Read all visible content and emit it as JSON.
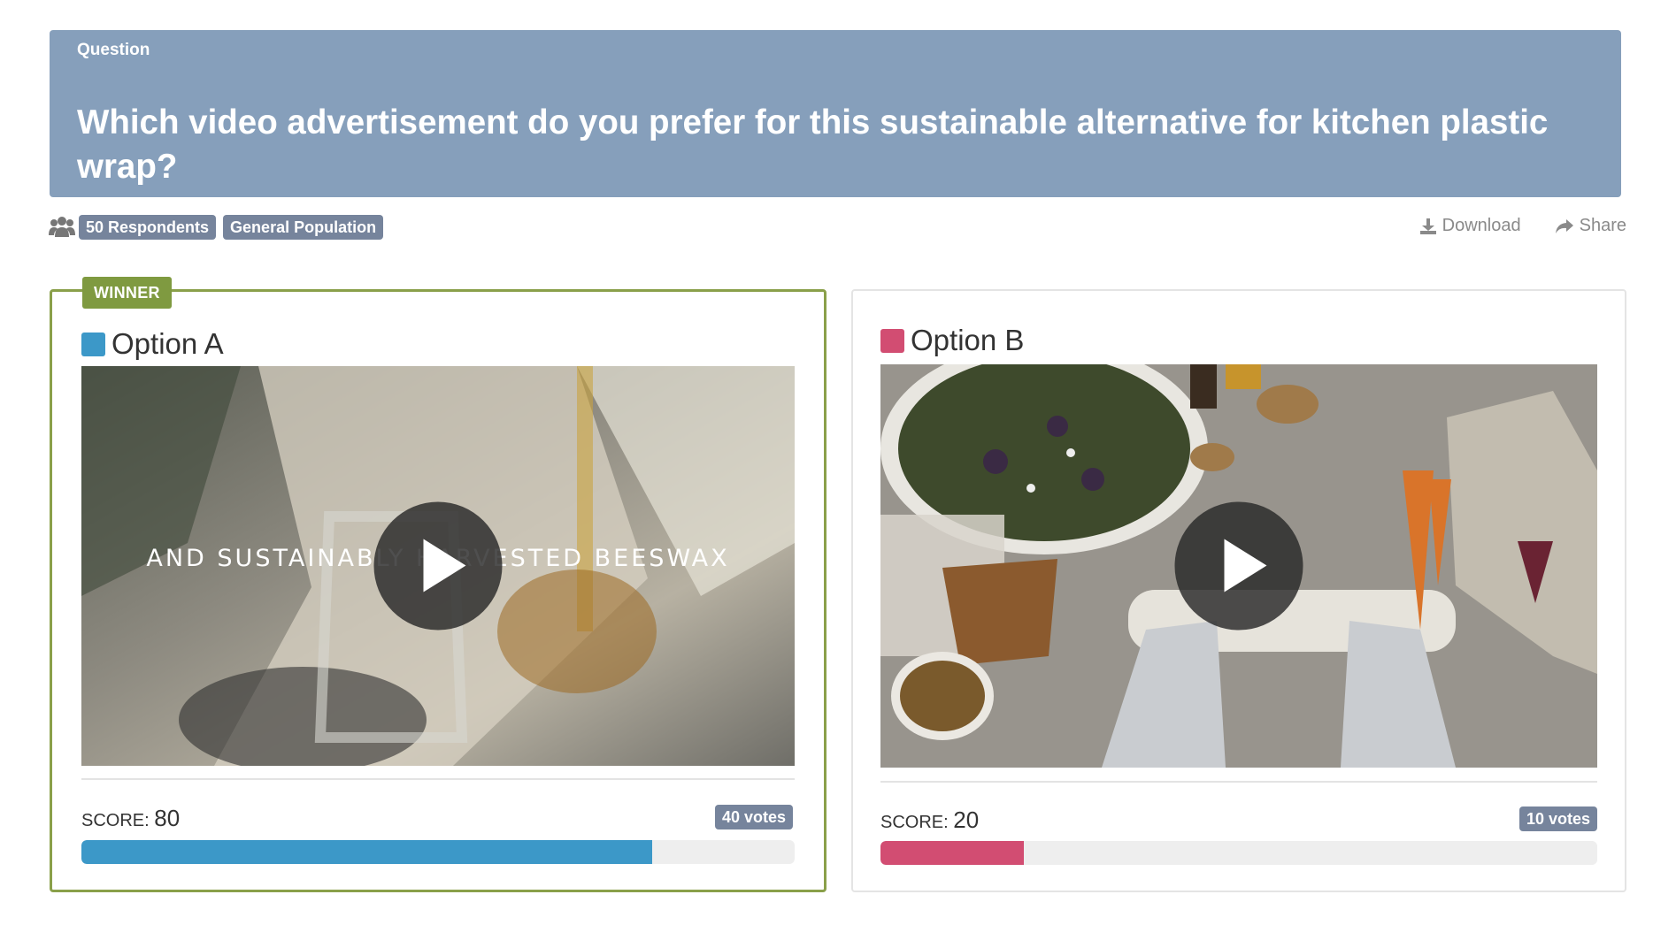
{
  "question": {
    "label": "Question",
    "text": "Which video advertisement do you prefer for this sustainable alternative for kitchen plastic wrap?"
  },
  "meta": {
    "icon": "people-icon",
    "respondents": "50 Respondents",
    "audience": "General Population"
  },
  "actions": {
    "download": "Download",
    "share": "Share"
  },
  "options": [
    {
      "winner_label": "WINNER",
      "title": "Option A",
      "color": "#3c98c8",
      "video_caption": "AND SUSTAINABLY HARVESTED BEESWAX",
      "score_label": "SCORE:",
      "score": "80",
      "score_fraction": 0.8,
      "votes": "40 votes"
    },
    {
      "title": "Option B",
      "color": "#d24d72",
      "score_label": "SCORE:",
      "score": "20",
      "score_fraction": 0.2,
      "votes": "10 votes"
    }
  ],
  "colors": {
    "header_bg": "#869fbb",
    "badge_bg": "#76849c",
    "winner_green": "#7f9a40"
  }
}
